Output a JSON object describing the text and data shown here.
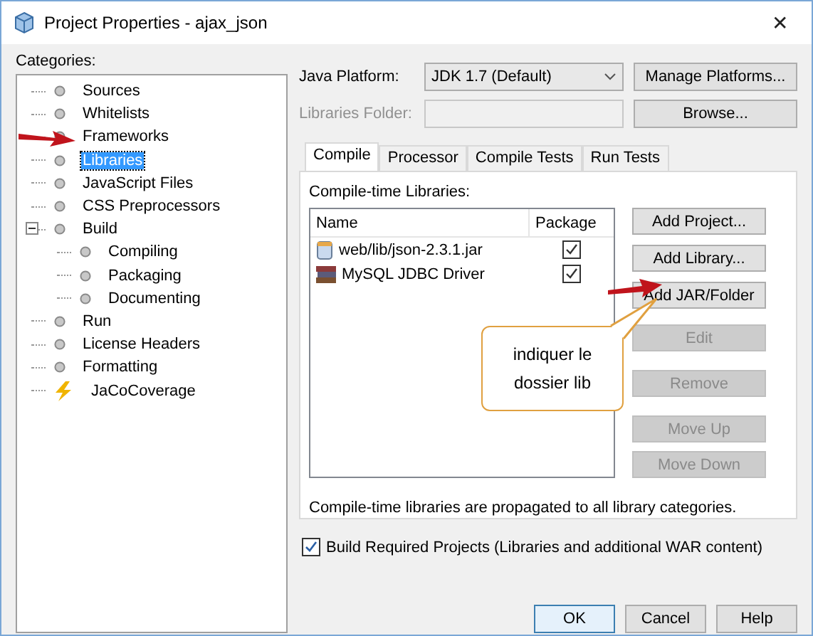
{
  "window": {
    "title": "Project Properties - ajax_json",
    "close": "✕"
  },
  "categories": {
    "label": "Categories:",
    "items": [
      {
        "label": "Sources",
        "kind": "node",
        "selected": false
      },
      {
        "label": "Whitelists",
        "kind": "node",
        "selected": false
      },
      {
        "label": "Frameworks",
        "kind": "node",
        "selected": false
      },
      {
        "label": "Libraries",
        "kind": "node",
        "selected": true
      },
      {
        "label": "JavaScript Files",
        "kind": "node",
        "selected": false
      },
      {
        "label": "CSS Preprocessors",
        "kind": "node",
        "selected": false
      },
      {
        "label": "Build",
        "kind": "node",
        "selected": false,
        "expanded": true,
        "children": [
          {
            "label": "Compiling",
            "kind": "node",
            "selected": false
          },
          {
            "label": "Packaging",
            "kind": "node",
            "selected": false
          },
          {
            "label": "Documenting",
            "kind": "node",
            "selected": false
          }
        ]
      },
      {
        "label": "Run",
        "kind": "node",
        "selected": false
      },
      {
        "label": "License Headers",
        "kind": "node",
        "selected": false
      },
      {
        "label": "Formatting",
        "kind": "node",
        "selected": false
      },
      {
        "label": "JaCoCoverage",
        "kind": "coverage",
        "selected": false
      }
    ]
  },
  "java_platform": {
    "label": "Java Platform:",
    "value": "JDK 1.7 (Default)",
    "button": "Manage Platforms..."
  },
  "libraries_folder": {
    "label": "Libraries Folder:",
    "disabled": true,
    "button": "Browse..."
  },
  "tabs": [
    {
      "label": "Compile",
      "selected": true
    },
    {
      "label": "Processor",
      "selected": false
    },
    {
      "label": "Compile Tests",
      "selected": false
    },
    {
      "label": "Run Tests",
      "selected": false
    }
  ],
  "compile": {
    "label": "Compile-time Libraries:",
    "columns": [
      "Name",
      "Package"
    ],
    "rows": [
      {
        "kind": "jar",
        "name": "web/lib/json-2.3.1.jar",
        "checked": true
      },
      {
        "kind": "library",
        "name": "MySQL JDBC Driver",
        "checked": true
      }
    ],
    "buttons": [
      {
        "label": "Add Project...",
        "disabled": false
      },
      {
        "label": "Add Library...",
        "disabled": false
      },
      {
        "label": "Add JAR/Folder",
        "disabled": false
      },
      {
        "label": "Edit",
        "disabled": true
      },
      {
        "label": "Remove",
        "disabled": true
      },
      {
        "label": "Move Up",
        "disabled": true
      },
      {
        "label": "Move Down",
        "disabled": true
      }
    ],
    "note": "Compile-time libraries are propagated to all library categories."
  },
  "build_required": {
    "label": "Build Required Projects (Libraries and additional WAR content)",
    "checked": true
  },
  "callout": "indiquer le dossier lib",
  "buttons": [
    {
      "label": "OK",
      "default": true
    },
    {
      "label": "Cancel",
      "default": false
    },
    {
      "label": "Help",
      "default": false
    }
  ]
}
